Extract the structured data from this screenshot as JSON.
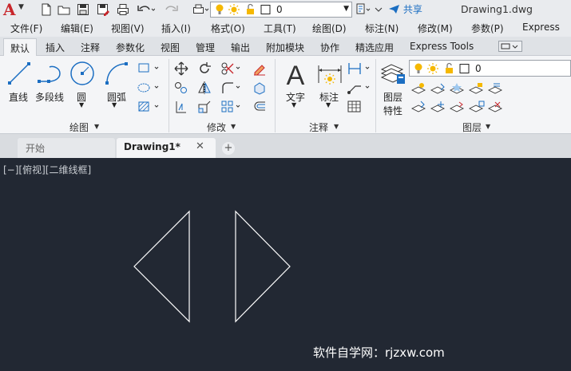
{
  "window": {
    "title": "Drawing1.dwg",
    "share_label": "共享",
    "layer_value": "0"
  },
  "menubar": [
    "文件(F)",
    "编辑(E)",
    "视图(V)",
    "插入(I)",
    "格式(O)",
    "工具(T)",
    "绘图(D)",
    "标注(N)",
    "修改(M)",
    "参数(P)",
    "Express"
  ],
  "ribbon_tabs": [
    "默认",
    "插入",
    "注释",
    "参数化",
    "视图",
    "管理",
    "输出",
    "附加模块",
    "协作",
    "精选应用",
    "Express Tools"
  ],
  "ribbon": {
    "draw": {
      "title": "绘图",
      "line": "直线",
      "polyline": "多段线",
      "circle": "圆",
      "arc": "圆弧"
    },
    "modify": {
      "title": "修改"
    },
    "annotation": {
      "title": "注释",
      "text": "文字",
      "dimension": "标注"
    },
    "layers": {
      "title": "图层",
      "properties_line1": "图层",
      "properties_line2": "特性",
      "layer_value": "0"
    }
  },
  "doc_tabs": {
    "start": "开始",
    "drawing": "Drawing1*"
  },
  "canvas": {
    "view_label": "[−][俯视][二维线框]",
    "watermark": "软件自学网：rjzxw.com"
  },
  "colors": {
    "canvas_bg": "#222833",
    "ribbon_bg": "#f4f5f7",
    "accent_red": "#c8262b",
    "accent_blue": "#1b6ec2",
    "bulb_yellow": "#f5b800"
  }
}
